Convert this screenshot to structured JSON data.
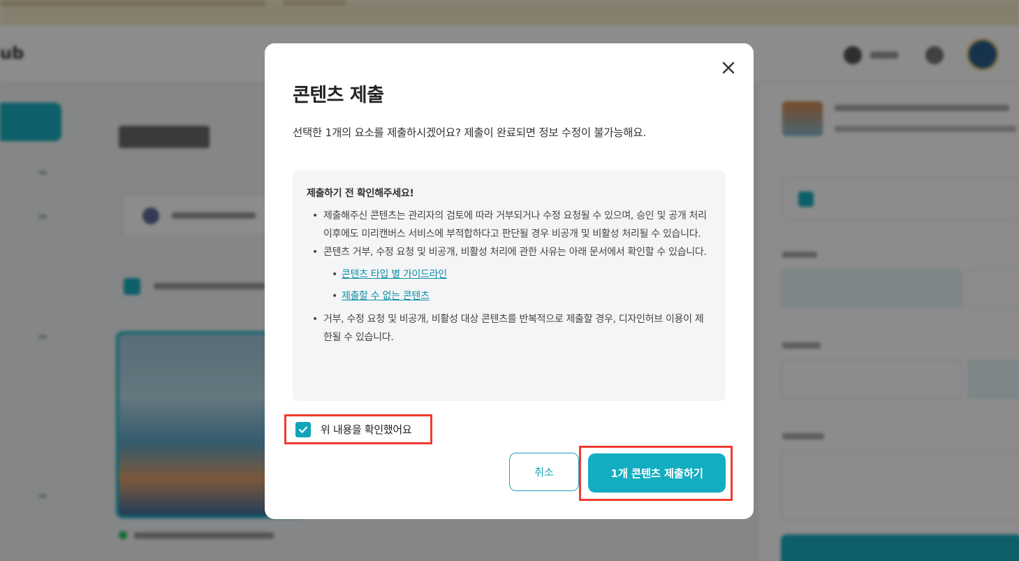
{
  "background": {
    "logo_text": "ub"
  },
  "modal": {
    "title": "콘텐츠 제출",
    "description": "선택한 1개의 요소를 제출하시겠어요? 제출이 완료되면 정보 수정이 불가능해요.",
    "close_icon": "close-icon",
    "notice": {
      "title": "제출하기 전 확인해주세요!",
      "items": [
        "제출해주신 콘텐츠는 관리자의 검토에 따라 거부되거나 수정 요청될 수 있으며, 승인 및 공개 처리 이후에도 미리캔버스 서비스에 부적합하다고 판단될 경우 비공개 및 비활성 처리될 수 있습니다.",
        "콘텐츠 거부, 수정 요청 및 비공개, 비활성 처리에 관한 사유는 아래 문서에서 확인할 수 있습니다.",
        "거부, 수정 요청 및 비공개, 비활성 대상 콘텐츠를 반복적으로 제출할 경우, 디자인허브 이용이 제한될 수 있습니다."
      ],
      "links": [
        "콘텐츠 타입 별 가이드라인",
        "제출할 수 없는 콘텐츠"
      ]
    },
    "confirm_checkbox": {
      "label": "위 내용을 확인했어요",
      "checked": true
    },
    "cancel_label": "취소",
    "submit_label": "1개 콘텐츠 제출하기"
  },
  "colors": {
    "accent": "#12adc0",
    "highlight": "#ef3b30"
  }
}
